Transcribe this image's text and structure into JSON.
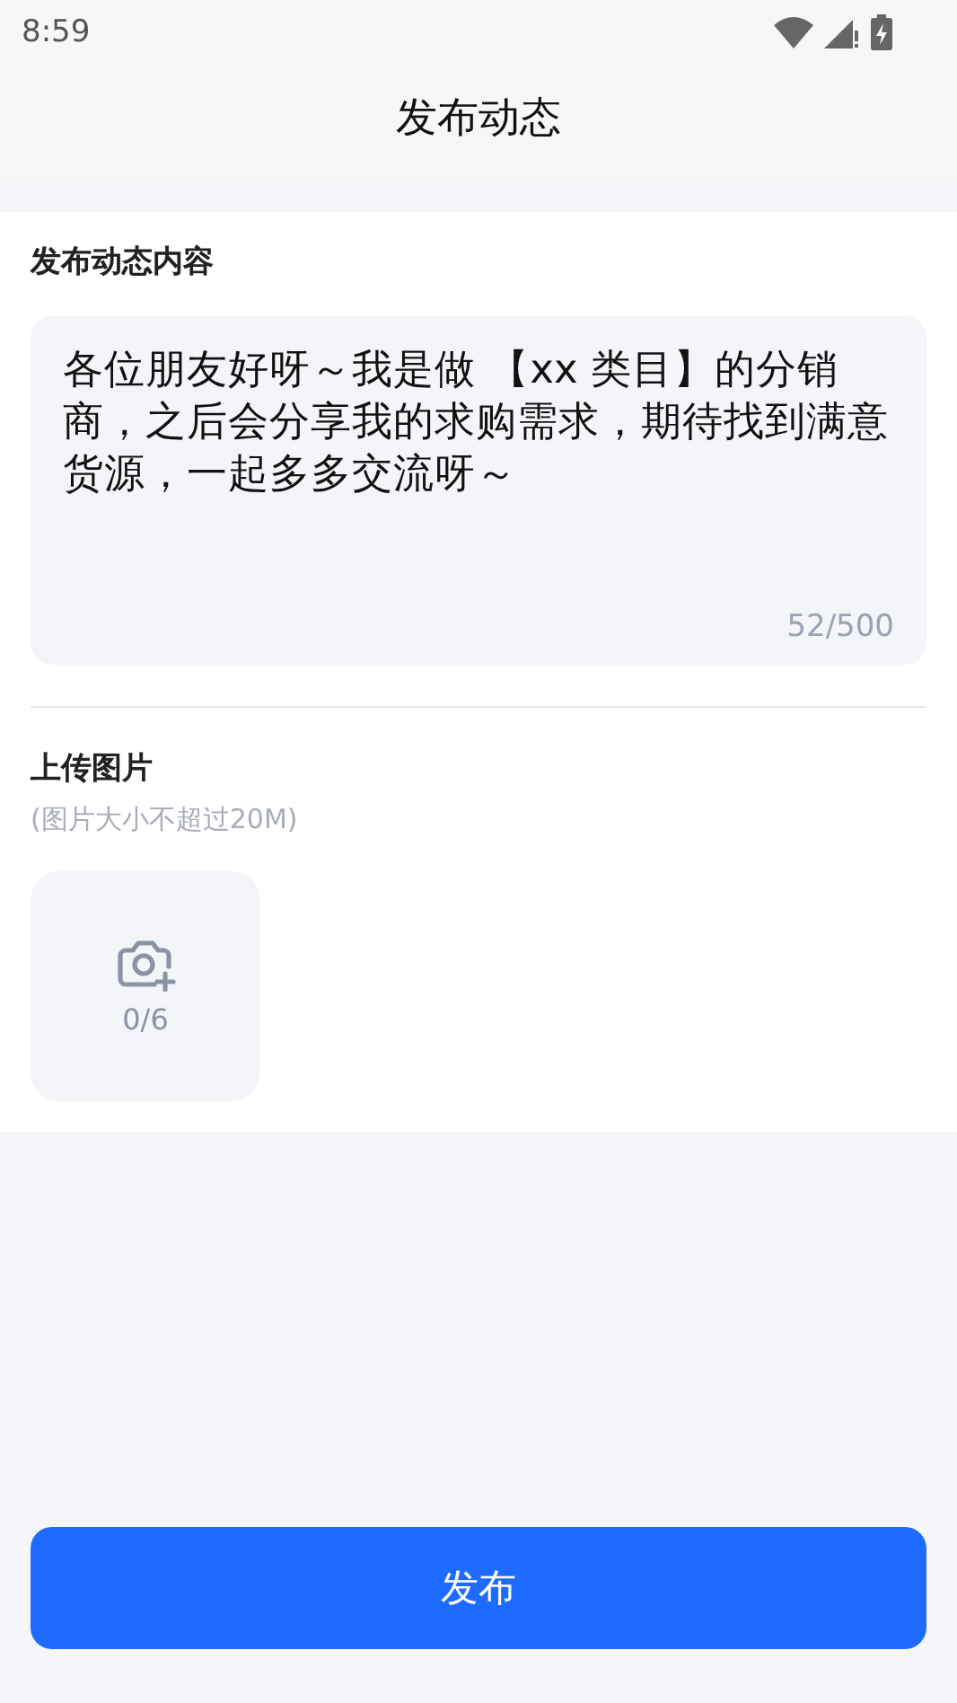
{
  "status_bar": {
    "time": "8:59"
  },
  "header": {
    "title": "发布动态"
  },
  "content": {
    "label": "发布动态内容",
    "value": "各位朋友好呀～我是做 【xx 类目】的分销商，之后会分享我的求购需求，期待找到满意货源，一起多多交流呀～",
    "counter": "52/500"
  },
  "upload": {
    "label": "上传图片",
    "hint": "(图片大小不超过20M)",
    "count": "0/6"
  },
  "submit": {
    "label": "发布"
  }
}
